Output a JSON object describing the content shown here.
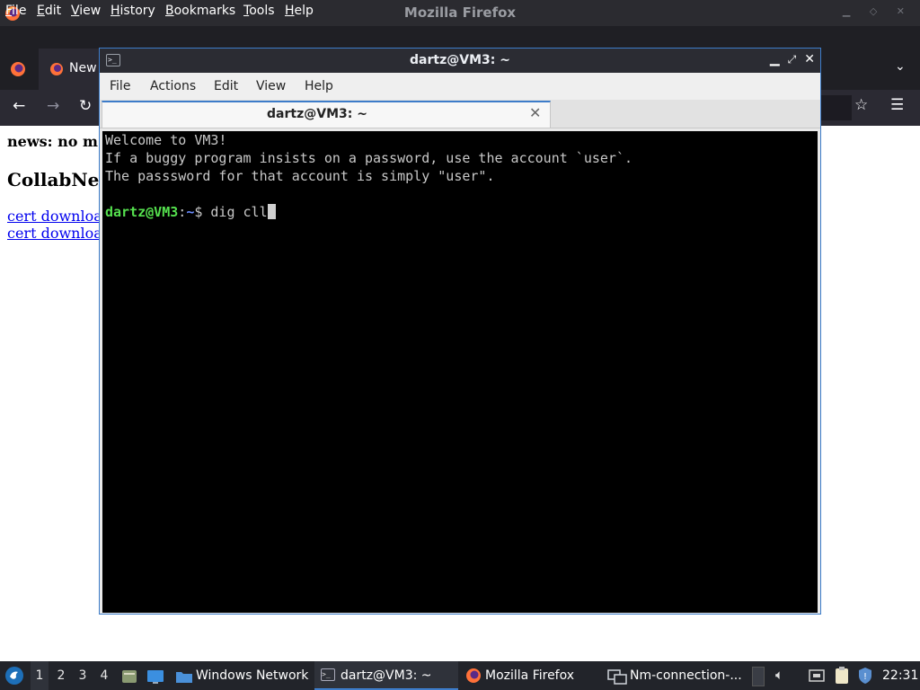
{
  "firefox": {
    "title": "Mozilla Firefox",
    "menu": [
      "File",
      "Edit",
      "View",
      "History",
      "Bookmarks",
      "Tools",
      "Help"
    ],
    "tab_label": "New",
    "page": {
      "news": "news: no m",
      "heading": "CollabNet",
      "links": [
        "cert downloa",
        "cert downloa"
      ]
    }
  },
  "terminal": {
    "title": "dartz@VM3: ~",
    "menu": [
      "File",
      "Actions",
      "Edit",
      "View",
      "Help"
    ],
    "tab_label": "dartz@VM3: ~",
    "lines": [
      "Welcome to VM3!",
      "If a buggy program insists on a password, use the account `user`.",
      "The passsword for that account is simply \"user\"."
    ],
    "prompt": {
      "user": "dartz@VM3",
      "sep": ":",
      "path": "~",
      "symbol": "$ ",
      "command": "dig cll"
    }
  },
  "taskbar": {
    "workspaces": [
      "1",
      "2",
      "3",
      "4"
    ],
    "tasks": [
      {
        "label": "Windows Network",
        "icon": "folder-icon"
      },
      {
        "label": "dartz@VM3: ~",
        "icon": "terminal-icon"
      },
      {
        "label": "Mozilla Firefox",
        "icon": "firefox-icon"
      },
      {
        "label": "Nm-connection-...",
        "icon": "network-connections-icon"
      }
    ],
    "clock": "22:31"
  },
  "colors": {
    "accent": "#3d7cc9",
    "prompt_user": "#55e04e",
    "prompt_path": "#6b8cff",
    "link": "#0000ee"
  }
}
